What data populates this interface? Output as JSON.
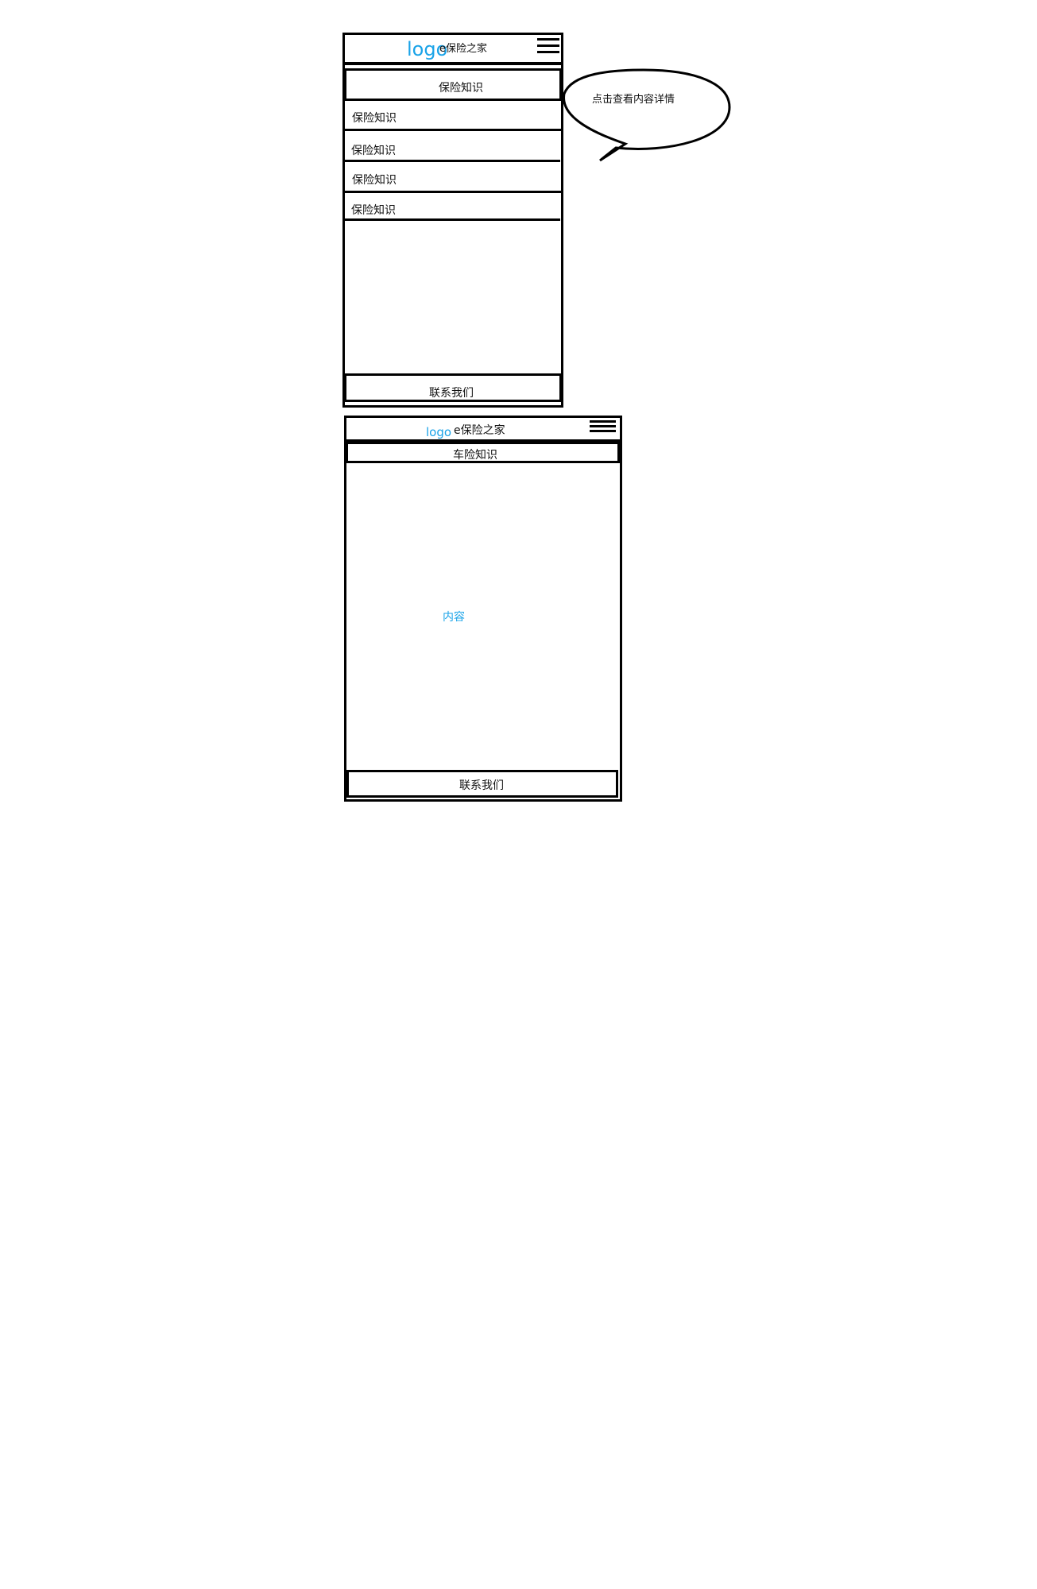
{
  "screen1": {
    "logo": "logo",
    "site_name": "e保险之家",
    "menu_icon": "hamburger-icon",
    "title": "保险知识",
    "items": [
      "保险知识",
      "保险知识",
      "保险知识",
      "保险知识"
    ],
    "footer": "联系我们"
  },
  "callout": {
    "text": "点击查看内容详情"
  },
  "screen2": {
    "logo": "logo",
    "site_name": "e保险之家",
    "menu_icon": "hamburger-icon",
    "title": "车险知识",
    "content": "内容",
    "footer": "联系我们"
  },
  "colors": {
    "accent": "#1aa3e8",
    "line": "#000000"
  }
}
